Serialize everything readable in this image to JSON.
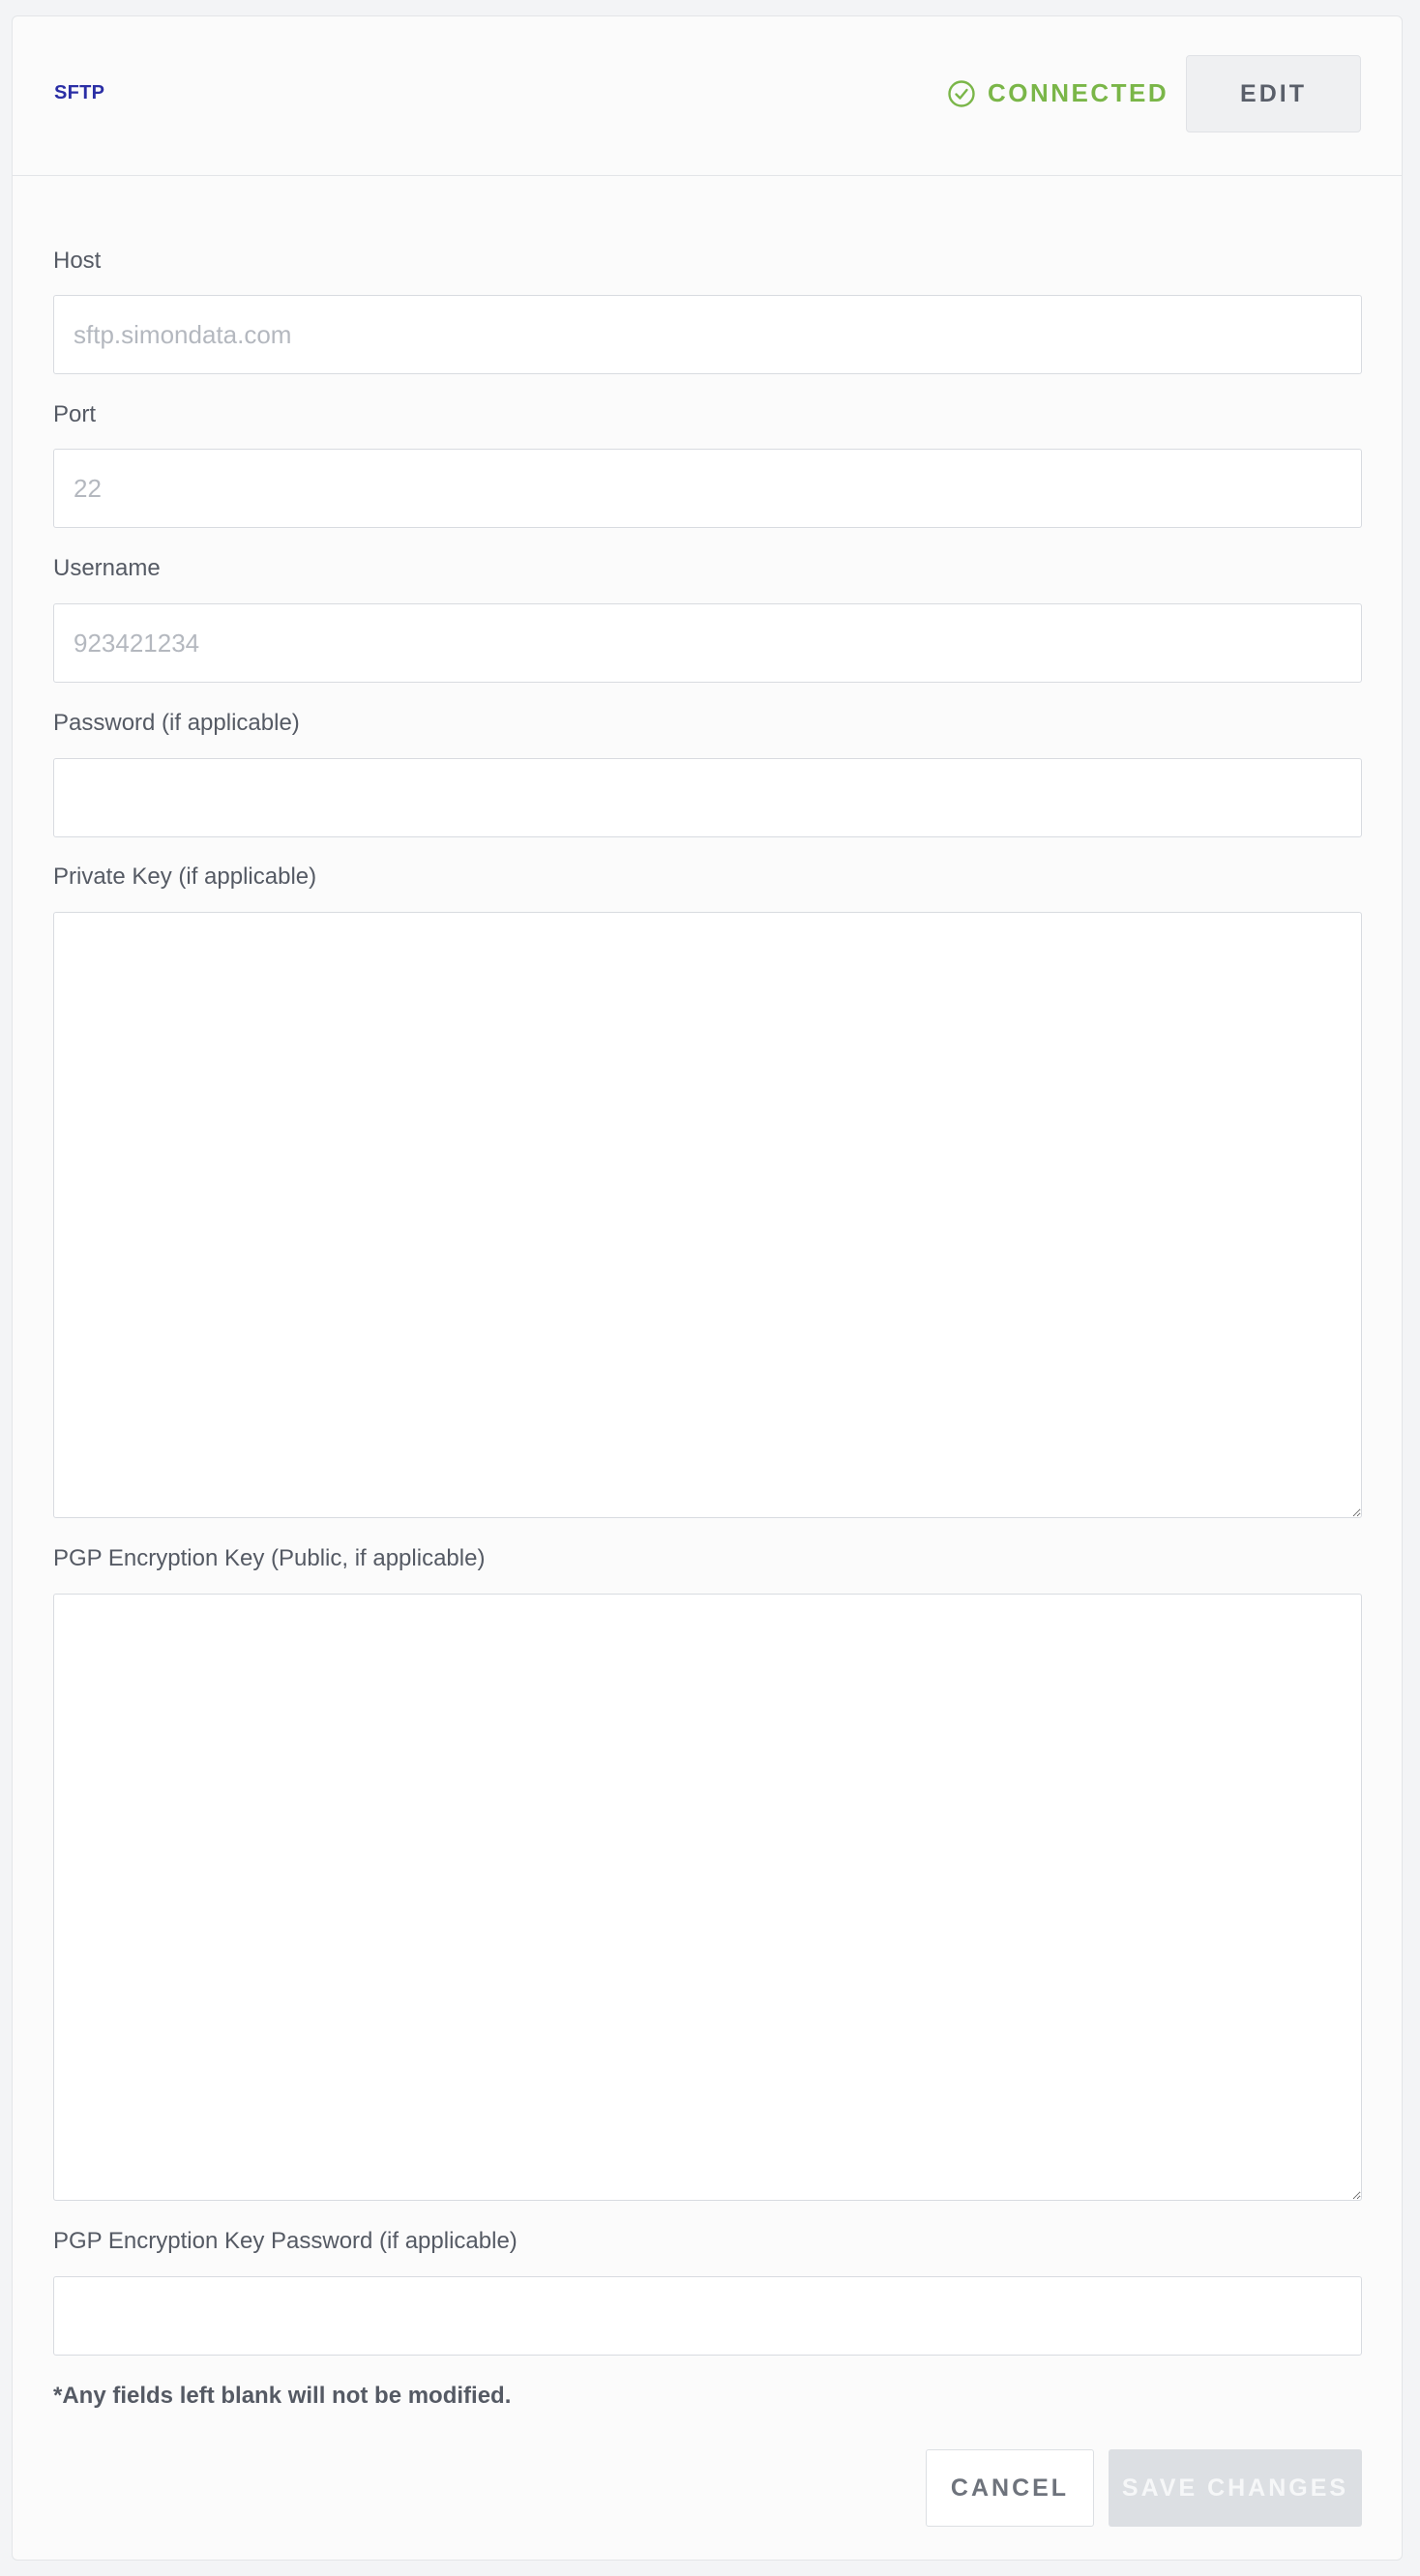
{
  "header": {
    "title": "SFTP",
    "status_text": "CONNECTED",
    "status_icon": "check-circle-icon",
    "status_color": "#7ab648",
    "edit_label": "EDIT"
  },
  "fields": {
    "host": {
      "label": "Host",
      "placeholder": "sftp.simondata.com",
      "value": ""
    },
    "port": {
      "label": "Port",
      "placeholder": "22",
      "value": ""
    },
    "username": {
      "label": "Username",
      "placeholder": "923421234",
      "value": ""
    },
    "password": {
      "label": "Password (if applicable)",
      "placeholder": "",
      "value": ""
    },
    "private_key": {
      "label": "Private Key (if applicable)",
      "value": ""
    },
    "pgp_key": {
      "label": "PGP Encryption Key (Public, if applicable)",
      "value": ""
    },
    "pgp_password": {
      "label": "PGP Encryption Key Password (if applicable)",
      "placeholder": "",
      "value": ""
    }
  },
  "note": "*Any fields left blank will not be modified.",
  "actions": {
    "cancel_label": "CANCEL",
    "save_label": "SAVE CHANGES"
  }
}
